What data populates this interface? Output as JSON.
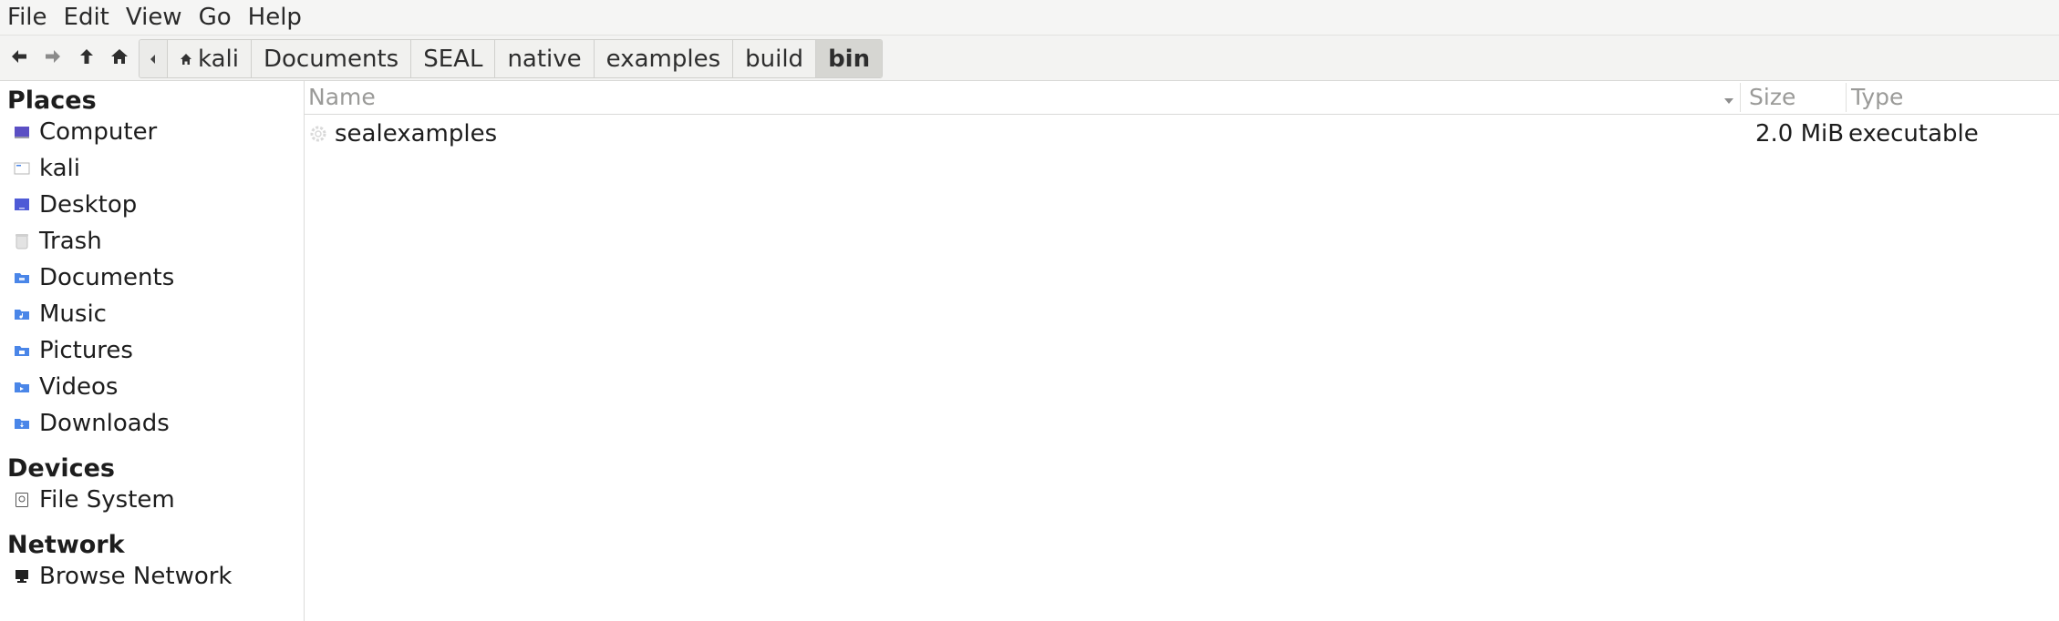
{
  "menubar": {
    "items": [
      "File",
      "Edit",
      "View",
      "Go",
      "Help"
    ]
  },
  "toolbar": {
    "breadcrumbs": [
      "kali",
      "Documents",
      "SEAL",
      "native",
      "examples",
      "build",
      "bin"
    ],
    "active_crumb": "bin"
  },
  "sidebar": {
    "places_header": "Places",
    "places": [
      {
        "label": "Computer",
        "icon": "computer-icon"
      },
      {
        "label": "kali",
        "icon": "home-folder-icon"
      },
      {
        "label": "Desktop",
        "icon": "desktop-icon"
      },
      {
        "label": "Trash",
        "icon": "trash-icon"
      },
      {
        "label": "Documents",
        "icon": "documents-folder-icon"
      },
      {
        "label": "Music",
        "icon": "music-folder-icon"
      },
      {
        "label": "Pictures",
        "icon": "pictures-folder-icon"
      },
      {
        "label": "Videos",
        "icon": "videos-folder-icon"
      },
      {
        "label": "Downloads",
        "icon": "downloads-folder-icon"
      }
    ],
    "devices_header": "Devices",
    "devices": [
      {
        "label": "File System",
        "icon": "drive-icon"
      }
    ],
    "network_header": "Network",
    "network": [
      {
        "label": "Browse Network",
        "icon": "network-icon"
      }
    ]
  },
  "filelist": {
    "columns": {
      "name": "Name",
      "size": "Size",
      "type": "Type"
    },
    "files": [
      {
        "name": "sealexamples",
        "size": "2.0 MiB",
        "type": "executable",
        "icon": "executable-icon"
      }
    ]
  },
  "colors": {
    "folder_blue": "#4a86e8",
    "active_crumb_bg": "#d6d6d2"
  }
}
